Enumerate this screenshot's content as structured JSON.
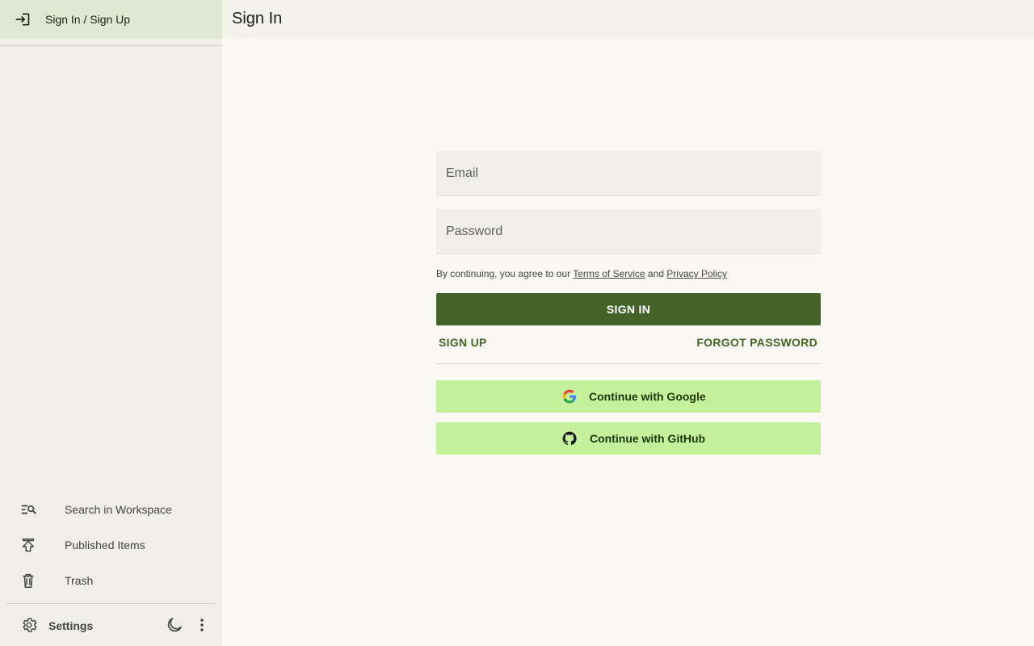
{
  "sidebar": {
    "auth_item": {
      "label": "Sign In / Sign Up",
      "icon": "login-icon"
    },
    "items": [
      {
        "label": "Search in Workspace",
        "icon": "search-list-icon"
      },
      {
        "label": "Published Items",
        "icon": "publish-icon"
      },
      {
        "label": "Trash",
        "icon": "trash-icon"
      }
    ],
    "settings": {
      "label": "Settings",
      "icon": "gear-icon"
    },
    "theme_icon": "moon-icon",
    "more_icon": "more-vertical-icon"
  },
  "header": {
    "title": "Sign In"
  },
  "form": {
    "email_placeholder": "Email",
    "password_placeholder": "Password",
    "terms_prefix": "By continuing, you agree to our ",
    "terms_link": "Terms of Service",
    "terms_and": " and ",
    "privacy_link": "Privacy Policy",
    "signin_label": "SIGN IN",
    "signup_label": "SIGN UP",
    "forgot_label": "FORGOT PASSWORD",
    "google_label": "Continue with Google",
    "github_label": "Continue with GitHub"
  },
  "colors": {
    "primary": "#436328",
    "oauth_bg": "#c5f09c",
    "sidebar_bg": "#efeee7",
    "selected_bg": "#dfe8d3",
    "page_bg": "#f9f8f2"
  }
}
